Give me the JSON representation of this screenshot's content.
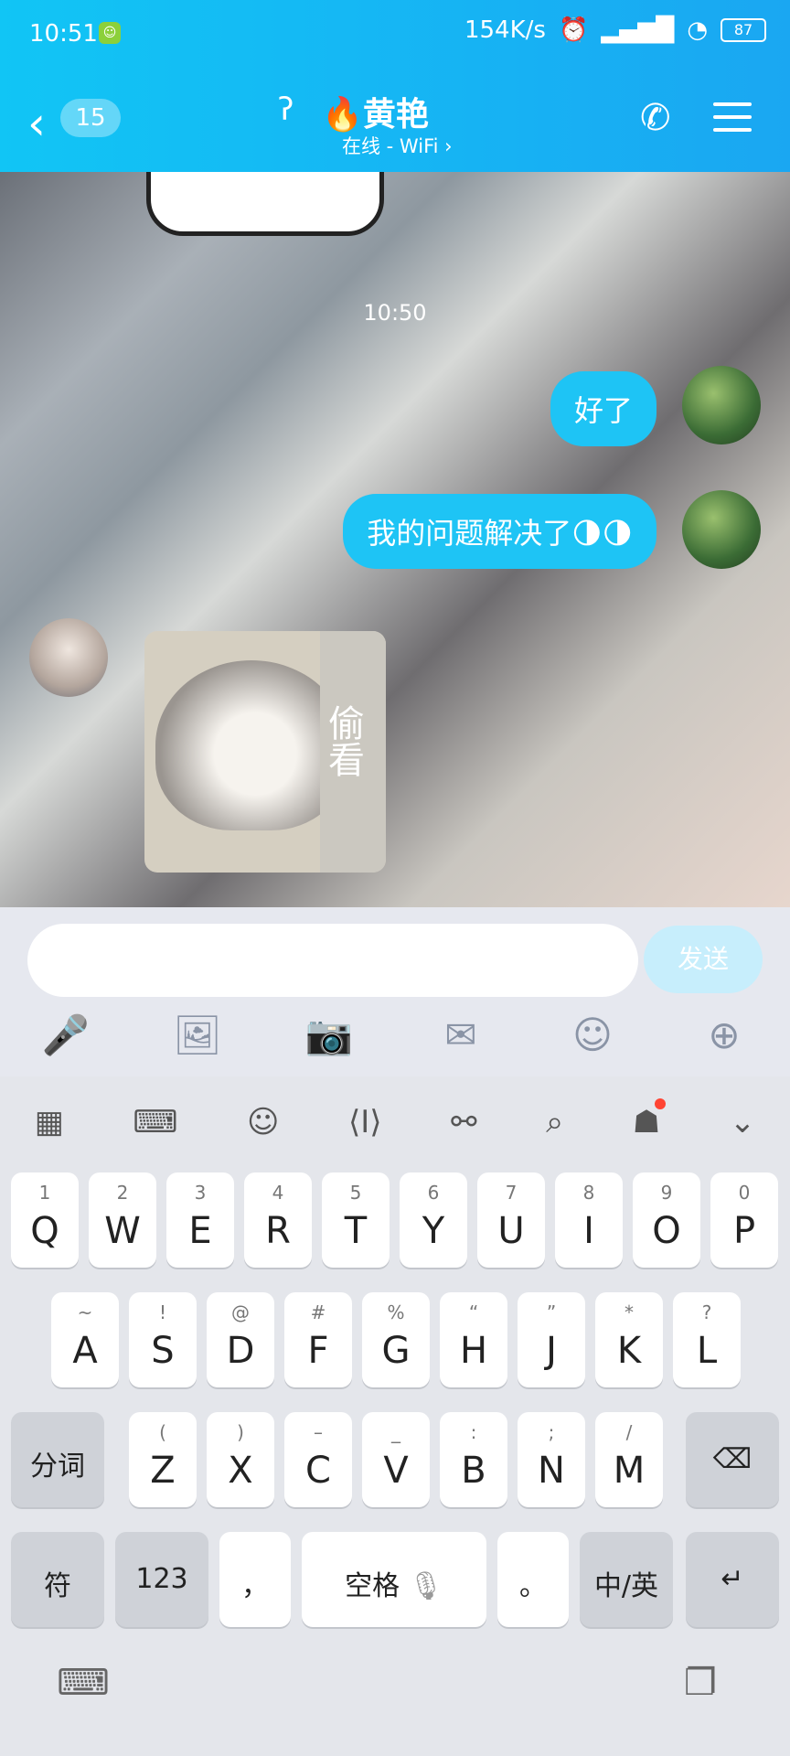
{
  "status": {
    "time": "10:51",
    "speed": "154K/s",
    "battery": "87"
  },
  "header": {
    "unread": "15",
    "title": "🔥黄艳",
    "subtitle": "在线 - WiFi ›"
  },
  "chat": {
    "timestamp": "10:50",
    "messages": [
      {
        "side": "right",
        "text": "好了"
      },
      {
        "side": "right",
        "text": "我的问题解决了🌗🌗"
      },
      {
        "side": "left",
        "sticker_text": "偷看"
      }
    ]
  },
  "input": {
    "placeholder": "",
    "send_label": "发送"
  },
  "keyboard": {
    "row1": [
      {
        "k": "Q",
        "s": "1"
      },
      {
        "k": "W",
        "s": "2"
      },
      {
        "k": "E",
        "s": "3"
      },
      {
        "k": "R",
        "s": "4"
      },
      {
        "k": "T",
        "s": "5"
      },
      {
        "k": "Y",
        "s": "6"
      },
      {
        "k": "U",
        "s": "7"
      },
      {
        "k": "I",
        "s": "8"
      },
      {
        "k": "O",
        "s": "9"
      },
      {
        "k": "P",
        "s": "0"
      }
    ],
    "row2": [
      {
        "k": "A",
        "s": "~"
      },
      {
        "k": "S",
        "s": "!"
      },
      {
        "k": "D",
        "s": "@"
      },
      {
        "k": "F",
        "s": "#"
      },
      {
        "k": "G",
        "s": "%"
      },
      {
        "k": "H",
        "s": "“"
      },
      {
        "k": "J",
        "s": "”"
      },
      {
        "k": "K",
        "s": "*"
      },
      {
        "k": "L",
        "s": "?"
      }
    ],
    "row3": [
      {
        "k": "Z",
        "s": "("
      },
      {
        "k": "X",
        "s": ")"
      },
      {
        "k": "C",
        "s": "–"
      },
      {
        "k": "V",
        "s": "_"
      },
      {
        "k": "B",
        "s": ":"
      },
      {
        "k": "N",
        "s": ";"
      },
      {
        "k": "M",
        "s": "/"
      }
    ],
    "fenci": "分词",
    "fu": "符",
    "num": "123",
    "comma": "，",
    "space": "空格",
    "period": "。",
    "lang": "中/英"
  }
}
